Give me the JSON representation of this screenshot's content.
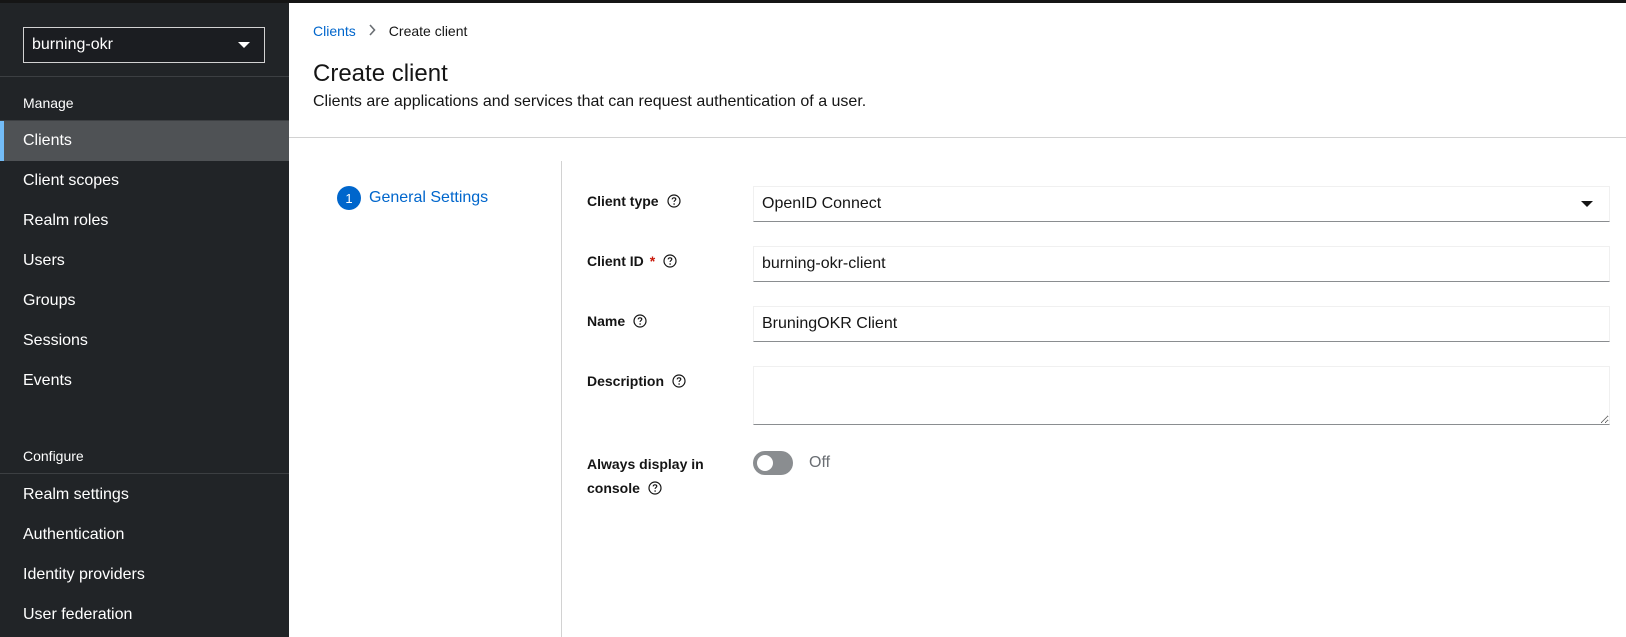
{
  "realm": {
    "selected": "burning-okr"
  },
  "sidebar": {
    "manage_label": "Manage",
    "manage_items": [
      {
        "label": "Clients",
        "active": true
      },
      {
        "label": "Client scopes"
      },
      {
        "label": "Realm roles"
      },
      {
        "label": "Users"
      },
      {
        "label": "Groups"
      },
      {
        "label": "Sessions"
      },
      {
        "label": "Events"
      }
    ],
    "configure_label": "Configure",
    "configure_items": [
      {
        "label": "Realm settings"
      },
      {
        "label": "Authentication"
      },
      {
        "label": "Identity providers"
      },
      {
        "label": "User federation"
      }
    ]
  },
  "breadcrumb": {
    "parent": "Clients",
    "current": "Create client"
  },
  "page": {
    "title": "Create client",
    "subtitle": "Clients are applications and services that can request authentication of a user."
  },
  "wizard": {
    "step_number": "1",
    "step_label": "General Settings"
  },
  "form": {
    "client_type": {
      "label": "Client type",
      "value": "OpenID Connect"
    },
    "client_id": {
      "label": "Client ID",
      "required_mark": "*",
      "value": "burning-okr-client"
    },
    "name": {
      "label": "Name",
      "value": "BruningOKR Client"
    },
    "description": {
      "label": "Description",
      "value": ""
    },
    "always_display": {
      "label_line1": "Always display in",
      "label_line2": "console",
      "state": "Off"
    }
  },
  "colors": {
    "accent": "#0066cc",
    "sidebar_bg": "#212427",
    "active_indicator": "#73bcf7",
    "required": "#c9190b"
  },
  "icons": {
    "help": "question-circle-icon",
    "caret": "caret-down-icon",
    "breadcrumb_separator": "chevron-right-icon"
  }
}
